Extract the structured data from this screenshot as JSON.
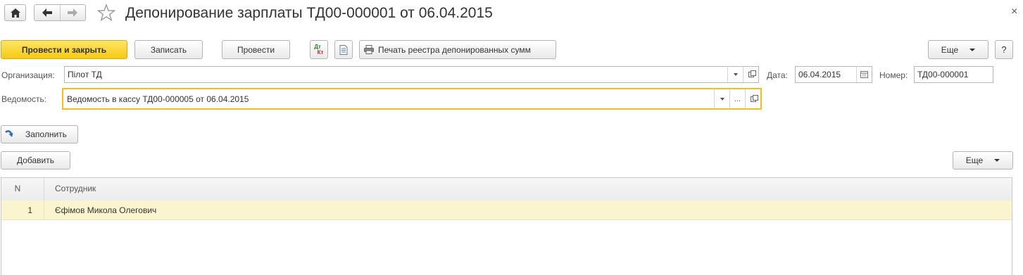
{
  "window": {
    "title": "Депонирование зарплаты ТД00-000001 от 06.04.2015",
    "close_glyph": "×"
  },
  "toolbar": {
    "post_close_label": "Провести и закрыть",
    "save_label": "Записать",
    "post_label": "Провести",
    "dt_kt_top": "Дт",
    "dt_kt_bottom": "Кт",
    "print_label": "Печать реестра депонированных сумм",
    "more_label": "Еще",
    "help_label": "?"
  },
  "form": {
    "organization_label": "Организация:",
    "organization_value": "Пілот ТД",
    "date_label": "Дата:",
    "date_value": "06.04.2015",
    "number_label": "Номер:",
    "number_value": "ТД00-000001",
    "statement_label": "Ведомость:",
    "statement_value": "Ведомость в кассу ТД00-000005 от 06.04.2015",
    "statement_dots": "..."
  },
  "fill_button_label": "Заполнить",
  "table_toolbar": {
    "add_label": "Добавить",
    "more_label": "Еще"
  },
  "table": {
    "columns": [
      "N",
      "Сотрудник"
    ],
    "rows": [
      {
        "n": "1",
        "employee": "Єфімов Микола Олегович"
      }
    ]
  },
  "colors": {
    "primary_button": "#f6c912",
    "focus_border": "#f0c020",
    "selected_row": "#fbf5cf"
  }
}
